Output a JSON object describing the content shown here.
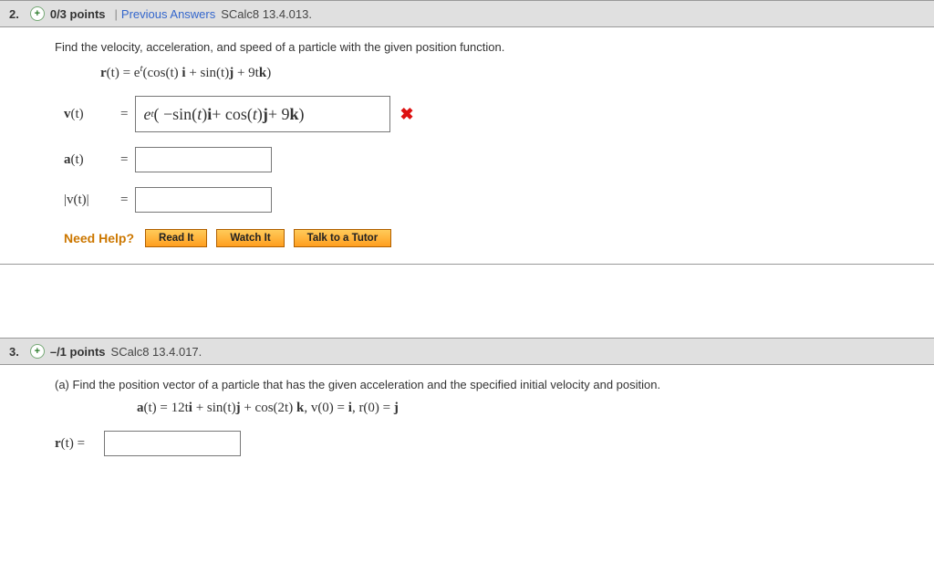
{
  "q2": {
    "number": "2.",
    "points": "0/3 points",
    "prev_answers": "Previous Answers",
    "refcode": "SCalc8 13.4.013.",
    "prompt": "Find the velocity, acceleration, and speed of a particle with the given position function.",
    "position_formula_prefix": "r",
    "position_formula_arg": "(t) = e",
    "position_formula_sup": "t",
    "position_formula_rest1": "(cos(t) ",
    "position_formula_i": "i",
    "position_formula_rest2": " + sin(t)",
    "position_formula_j": "j",
    "position_formula_rest3": " + 9t",
    "position_formula_k": "k",
    "position_formula_end": ")",
    "v_label": "v",
    "v_arg": "(t)",
    "answer_entered": "eᵗ( −sin(t)i + cos(t)j + 9k )",
    "a_label": "a",
    "a_arg": "(t)",
    "mag_label": "|v(t)|",
    "need_help": "Need Help?",
    "read_it": "Read It",
    "watch_it": "Watch It",
    "talk_tutor": "Talk to a Tutor"
  },
  "q3": {
    "number": "3.",
    "points": "–/1 points",
    "refcode": "SCalc8 13.4.017.",
    "prompt": "(a) Find the position vector of a particle that has the given acceleration and the specified initial velocity and position.",
    "formula_a": "a",
    "formula_a_rest": "(t) = 12t",
    "formula_i": "i",
    "formula_mid1": " + sin(t)",
    "formula_j": "j",
    "formula_mid2": " + cos(2t) ",
    "formula_k": "k",
    "formula_v0": ",    v(0) = ",
    "formula_i2": "i",
    "formula_r0": ",    r(0) = ",
    "formula_j2": "j",
    "r_label": "r",
    "r_arg": "(t) ="
  }
}
